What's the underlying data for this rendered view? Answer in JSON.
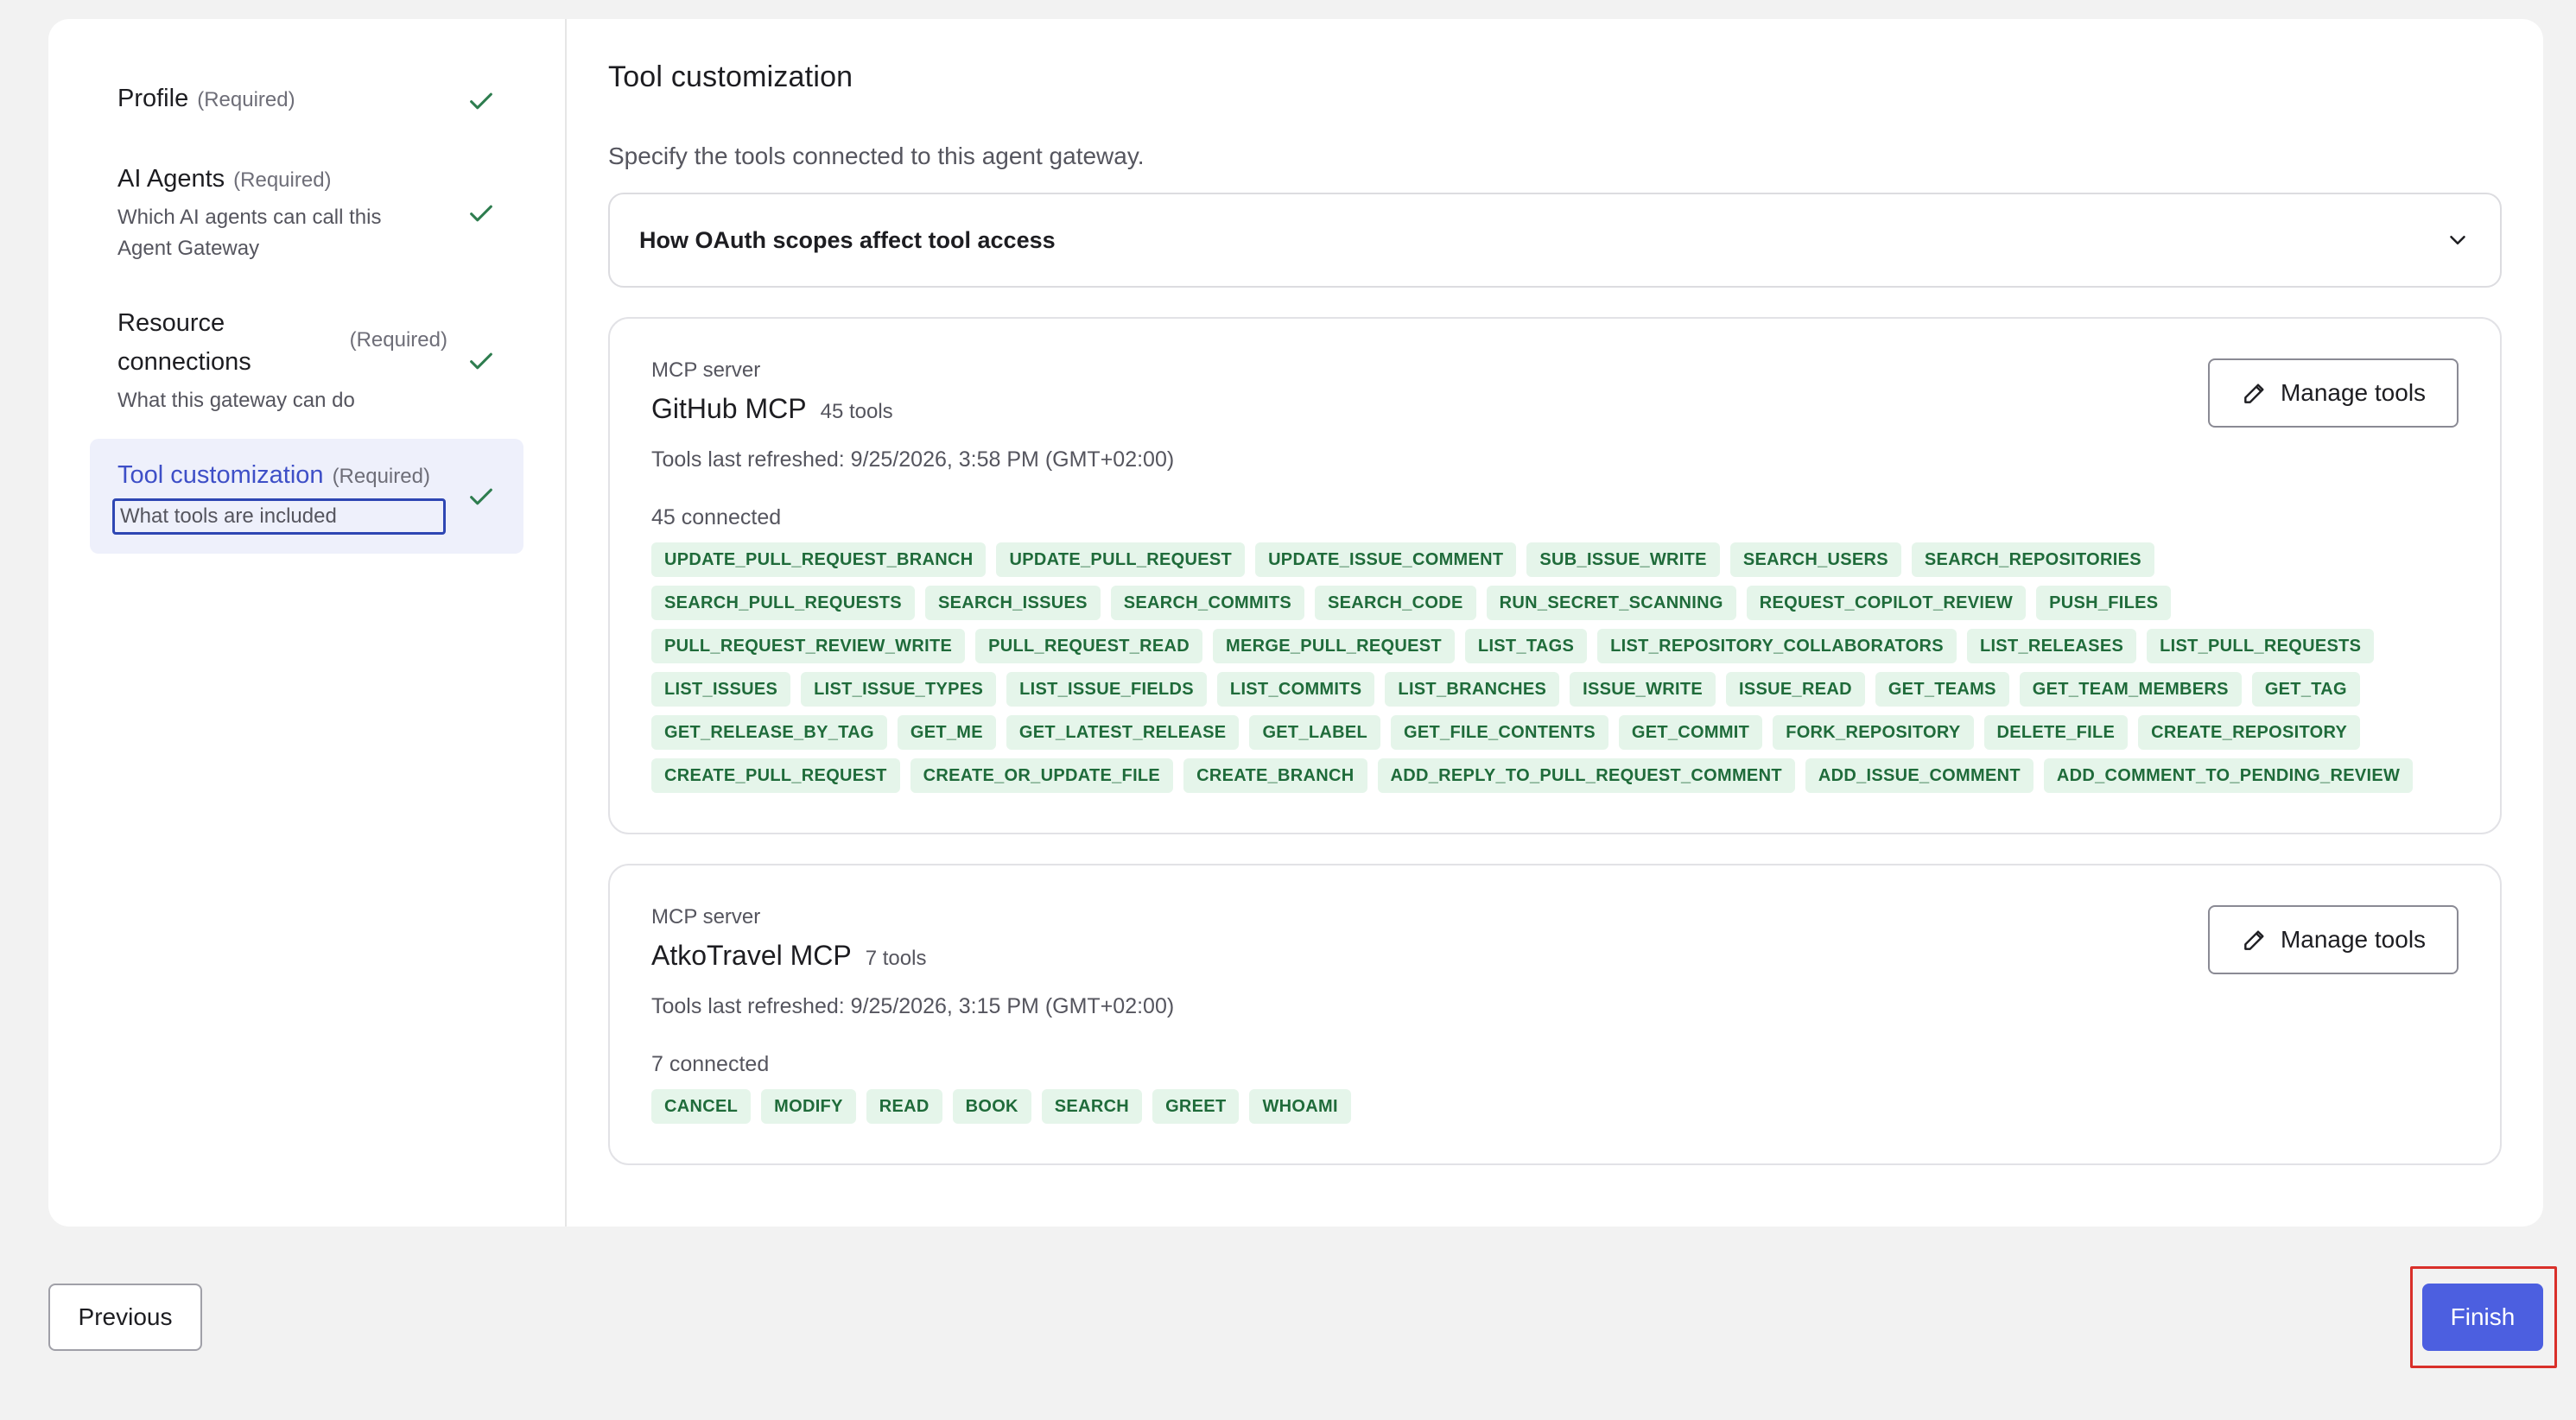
{
  "sidebar": {
    "steps": [
      {
        "title": "Profile",
        "required": "(Required)",
        "desc": ""
      },
      {
        "title": "AI Agents",
        "required": "(Required)",
        "desc": "Which AI agents can call this Agent Gateway"
      },
      {
        "title": "Resource connections",
        "required": "(Required)",
        "desc": "What this gateway can do"
      },
      {
        "title": "Tool customization",
        "required": "(Required)",
        "desc": "What tools are included"
      }
    ]
  },
  "main": {
    "title": "Tool customization",
    "subtitle": "Specify the tools connected to this agent gateway.",
    "accordion_title": "How OAuth scopes affect tool access",
    "servers": [
      {
        "kicker": "MCP server",
        "name": "GitHub MCP",
        "count": "45 tools",
        "refreshed": "Tools last refreshed: 9/25/2026, 3:58 PM (GMT+02:00)",
        "connected": "45 connected",
        "manage_label": "Manage tools",
        "tools": [
          "UPDATE_PULL_REQUEST_BRANCH",
          "UPDATE_PULL_REQUEST",
          "UPDATE_ISSUE_COMMENT",
          "SUB_ISSUE_WRITE",
          "SEARCH_USERS",
          "SEARCH_REPOSITORIES",
          "SEARCH_PULL_REQUESTS",
          "SEARCH_ISSUES",
          "SEARCH_COMMITS",
          "SEARCH_CODE",
          "RUN_SECRET_SCANNING",
          "REQUEST_COPILOT_REVIEW",
          "PUSH_FILES",
          "PULL_REQUEST_REVIEW_WRITE",
          "PULL_REQUEST_READ",
          "MERGE_PULL_REQUEST",
          "LIST_TAGS",
          "LIST_REPOSITORY_COLLABORATORS",
          "LIST_RELEASES",
          "LIST_PULL_REQUESTS",
          "LIST_ISSUES",
          "LIST_ISSUE_TYPES",
          "LIST_ISSUE_FIELDS",
          "LIST_COMMITS",
          "LIST_BRANCHES",
          "ISSUE_WRITE",
          "ISSUE_READ",
          "GET_TEAMS",
          "GET_TEAM_MEMBERS",
          "GET_TAG",
          "GET_RELEASE_BY_TAG",
          "GET_ME",
          "GET_LATEST_RELEASE",
          "GET_LABEL",
          "GET_FILE_CONTENTS",
          "GET_COMMIT",
          "FORK_REPOSITORY",
          "DELETE_FILE",
          "CREATE_REPOSITORY",
          "CREATE_PULL_REQUEST",
          "CREATE_OR_UPDATE_FILE",
          "CREATE_BRANCH",
          "ADD_REPLY_TO_PULL_REQUEST_COMMENT",
          "ADD_ISSUE_COMMENT",
          "ADD_COMMENT_TO_PENDING_REVIEW"
        ]
      },
      {
        "kicker": "MCP server",
        "name": "AtkoTravel MCP",
        "count": "7 tools",
        "refreshed": "Tools last refreshed: 9/25/2026, 3:15 PM (GMT+02:00)",
        "connected": "7 connected",
        "manage_label": "Manage tools",
        "tools": [
          "CANCEL",
          "MODIFY",
          "READ",
          "BOOK",
          "SEARCH",
          "GREET",
          "WHOAMI"
        ]
      }
    ]
  },
  "footer": {
    "previous_label": "Previous",
    "finish_label": "Finish"
  },
  "colors": {
    "accent": "#4c5fe0",
    "check": "#2e7d4f",
    "chip_bg": "#e5f5ea",
    "chip_text": "#1f6b3a",
    "highlight": "#d9302a"
  },
  "icons": {
    "step_complete": "check-icon",
    "accordion": "chevron-down-icon",
    "manage": "pencil-icon"
  }
}
